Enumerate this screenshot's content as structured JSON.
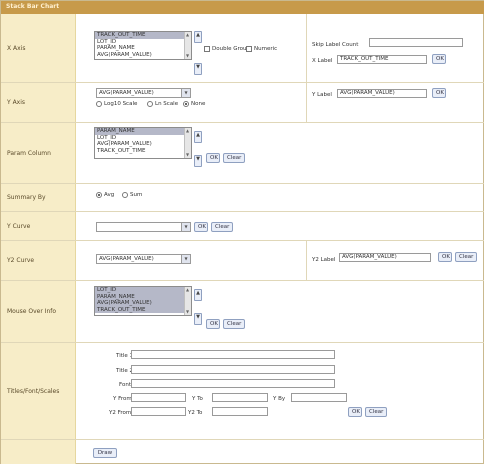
{
  "title": "Stack Bar Chart",
  "xaxis": {
    "label": "X Axis",
    "list_items": [
      "TRACK_OUT_TIME",
      "LOT_ID",
      "PARAM_NAME",
      "AVG(PARAM_VALUE)"
    ],
    "double_group_label": "Double Group",
    "numeric_label": "Numeric",
    "skip_label_count_label": "Skip Label Count",
    "skip_label_count_value": "",
    "x_label_label": "X Label",
    "x_label_value": "TRACK_OUT_TIME",
    "ok": "OK"
  },
  "yaxis": {
    "label": "Y Axis",
    "select_value": "AVG(PARAM_VALUE)",
    "scale_options": [
      "Log10 Scale",
      "Ln Scale",
      "None"
    ],
    "scale_selected": "None",
    "y_label_label": "Y Label",
    "y_label_value": "AVG(PARAM_VALUE)",
    "ok": "OK"
  },
  "param_column": {
    "label": "Param Column",
    "list_items": [
      "PARAM_NAME",
      "LOT_ID",
      "AVG(PARAM_VALUE)",
      "TRACK_OUT_TIME"
    ],
    "ok": "OK",
    "clear": "Clear"
  },
  "summary_by": {
    "label": "Summary By",
    "options": [
      "Avg",
      "Sum"
    ],
    "selected": "Avg"
  },
  "ycurve": {
    "label": "Y Curve",
    "select_value": "",
    "ok": "OK",
    "clear": "Clear"
  },
  "y2curve": {
    "label": "Y2 Curve",
    "select_value": "AVG(PARAM_VALUE)",
    "y2_label_label": "Y2 Label",
    "y2_label_value": "AVG(PARAM_VALUE)",
    "ok": "OK",
    "clear": "Clear"
  },
  "mouse_over": {
    "label": "Mouse Over Info",
    "list_items": [
      "LOT_ID",
      "PARAM_NAME",
      "AVG(PARAM_VALUE)",
      "TRACK_OUT_TIME"
    ],
    "ok": "OK",
    "clear": "Clear"
  },
  "titles": {
    "label": "Titles/Font/Scales",
    "title1": "Title 1",
    "title2": "Title 2",
    "font": "Font",
    "y_from": "Y From",
    "y_to": "Y To",
    "y_by": "Y By",
    "y2_from": "Y2 From",
    "y2_to": "Y2 To",
    "ok": "OK",
    "clear": "Clear"
  },
  "draw": "Draw"
}
